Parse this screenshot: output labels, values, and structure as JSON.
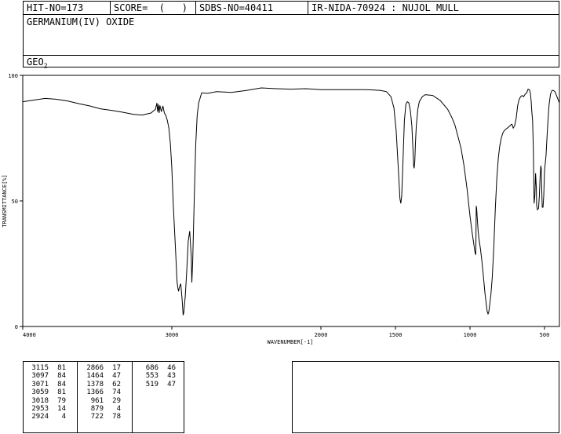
{
  "header": {
    "hit_no": "HIT-NO=173",
    "score": "SCORE=  (   )",
    "sdbs_no": "SDBS-NO=40411",
    "ir_nida": "IR-NIDA-70924 : NUJOL MULL",
    "compound_name": "GERMANIUM(IV) OXIDE",
    "formula_base": "GEO",
    "formula_sub": "2"
  },
  "chart_data": {
    "type": "line",
    "xlabel": "WAVENUMBER[-1]",
    "ylabel": "TRANSMITTANCE[%]",
    "xlim": [
      4000,
      400
    ],
    "ylim": [
      0,
      100
    ],
    "x_ticks": [
      "4000",
      "3000",
      "2000",
      "1500",
      "1000",
      "500"
    ],
    "y_ticks": [
      "0",
      "50",
      "100"
    ],
    "series": [
      {
        "x": [
          4000,
          3920,
          3850,
          3780,
          3700,
          3620,
          3550,
          3480,
          3400,
          3330,
          3260,
          3200,
          3140,
          3110,
          3100,
          3095,
          3090,
          3085,
          3080,
          3070,
          3060,
          3050,
          3040,
          3030,
          3020,
          3010,
          3000,
          2990,
          2975,
          2965,
          2960,
          2955,
          2950,
          2940,
          2930,
          2924,
          2920,
          2910,
          2900,
          2890,
          2880,
          2870,
          2866,
          2860,
          2850,
          2840,
          2830,
          2820,
          2800,
          2760,
          2700,
          2600,
          2500,
          2400,
          2300,
          2200,
          2100,
          2000,
          1900,
          1800,
          1700,
          1650,
          1600,
          1560,
          1530,
          1510,
          1495,
          1480,
          1470,
          1464,
          1458,
          1450,
          1440,
          1430,
          1420,
          1410,
          1400,
          1390,
          1382,
          1378,
          1375,
          1370,
          1366,
          1360,
          1350,
          1340,
          1320,
          1300,
          1250,
          1200,
          1150,
          1120,
          1100,
          1080,
          1060,
          1040,
          1020,
          1000,
          985,
          975,
          968,
          961,
          958,
          955,
          950,
          945,
          940,
          930,
          920,
          910,
          900,
          890,
          885,
          879,
          875,
          870,
          860,
          850,
          840,
          830,
          820,
          810,
          800,
          790,
          780,
          770,
          760,
          750,
          740,
          730,
          722,
          718,
          715,
          710,
          700,
          690,
          680,
          670,
          660,
          650,
          640,
          630,
          620,
          610,
          600,
          595,
          590,
          586,
          580,
          575,
          570,
          565,
          560,
          555,
          553,
          548,
          540,
          535,
          530,
          525,
          522,
          519,
          515,
          510,
          505,
          500,
          490,
          480,
          470,
          460,
          450,
          440,
          430,
          420,
          410,
          400
        ],
        "y": [
          89.5,
          90.2,
          90.8,
          90.5,
          89.8,
          88.7,
          87.8,
          86.7,
          86.0,
          85.3,
          84.5,
          84.2,
          85.0,
          86.5,
          89.0,
          85.5,
          88.5,
          85.0,
          88.0,
          85.5,
          87.8,
          85.0,
          84.0,
          82.0,
          79.0,
          73.0,
          63.0,
          48.0,
          30.0,
          18.0,
          15.5,
          14.0,
          15.5,
          17.0,
          10.0,
          4.5,
          5.5,
          12.0,
          22.0,
          34.0,
          38.0,
          28.0,
          17.5,
          26.0,
          50.0,
          72.0,
          84.0,
          89.0,
          93.0,
          92.8,
          93.5,
          93.2,
          94.0,
          95.0,
          94.7,
          94.5,
          94.7,
          94.3,
          94.3,
          94.3,
          94.3,
          94.2,
          94.0,
          93.5,
          91.5,
          87.0,
          78.0,
          62.0,
          51.0,
          49.0,
          52.0,
          65.0,
          82.0,
          88.5,
          89.5,
          89.0,
          86.0,
          80.0,
          70.0,
          64.0,
          63.0,
          66.0,
          73.0,
          80.0,
          86.5,
          89.5,
          91.5,
          92.3,
          92.0,
          90.0,
          86.5,
          83.0,
          80.0,
          75.5,
          71.0,
          64.0,
          55.0,
          44.0,
          37.0,
          33.0,
          30.0,
          28.5,
          48.0,
          47.0,
          42.0,
          38.0,
          35.0,
          31.0,
          26.0,
          20.0,
          13.5,
          8.5,
          6.0,
          5.0,
          5.5,
          7.5,
          12.5,
          20.0,
          32.0,
          47.0,
          59.0,
          67.0,
          72.0,
          75.0,
          77.0,
          78.0,
          78.5,
          79.0,
          79.5,
          80.0,
          80.5,
          80.5,
          80.0,
          79.0,
          80.0,
          83.0,
          88.0,
          90.5,
          91.5,
          92.0,
          91.5,
          92.5,
          93.0,
          94.5,
          94.2,
          93.0,
          90.0,
          86.0,
          82.0,
          70.0,
          49.0,
          52.0,
          61.0,
          55.0,
          48.5,
          46.5,
          47.0,
          52.0,
          59.0,
          64.0,
          63.0,
          55.0,
          47.5,
          47.5,
          52.0,
          62.0,
          68.0,
          79.0,
          88.0,
          92.5,
          94.0,
          94.0,
          93.5,
          92.0,
          90.5,
          89.0
        ]
      }
    ],
    "grid": false
  },
  "peaks": {
    "columns": [
      [
        [
          "3115",
          "81"
        ],
        [
          "3097",
          "84"
        ],
        [
          "3071",
          "84"
        ],
        [
          "3059",
          "81"
        ],
        [
          "3018",
          "79"
        ],
        [
          "2953",
          "14"
        ],
        [
          "2924",
          "4"
        ]
      ],
      [
        [
          "2866",
          "17"
        ],
        [
          "1464",
          "47"
        ],
        [
          "1378",
          "62"
        ],
        [
          "1366",
          "74"
        ],
        [
          "961",
          "29"
        ],
        [
          "879",
          "4"
        ],
        [
          "722",
          "78"
        ]
      ],
      [
        [
          "686",
          "46"
        ],
        [
          "553",
          "43"
        ],
        [
          "519",
          "47"
        ]
      ]
    ]
  }
}
